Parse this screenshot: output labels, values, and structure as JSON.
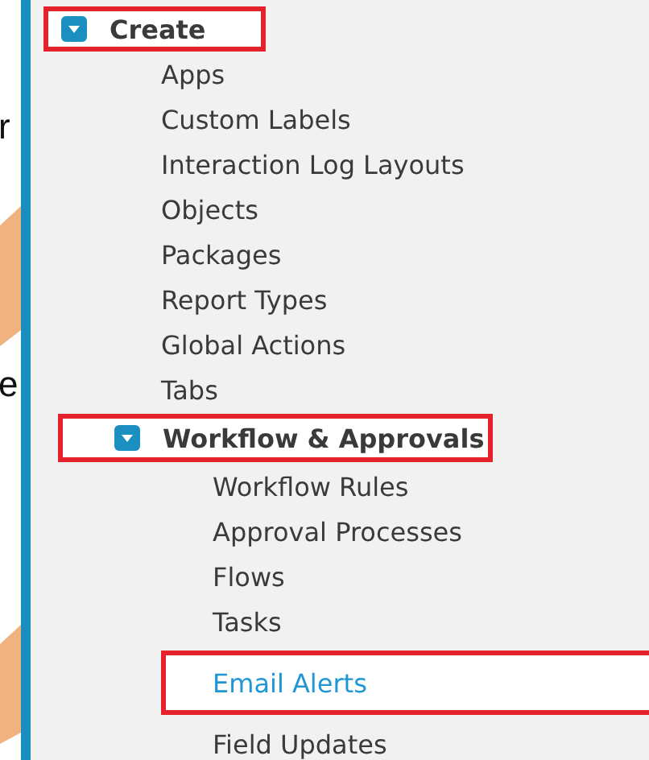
{
  "background_fragments": [
    {
      "text": "r"
    },
    {
      "text": "e"
    }
  ],
  "tree": [
    {
      "label": "Create",
      "expanded": true,
      "highlighted": true,
      "children": [
        {
          "label": "Apps",
          "highlighted": false,
          "selected": false
        },
        {
          "label": "Custom Labels",
          "highlighted": false,
          "selected": false
        },
        {
          "label": "Interaction Log Layouts",
          "highlighted": false,
          "selected": false
        },
        {
          "label": "Objects",
          "highlighted": false,
          "selected": false
        },
        {
          "label": "Packages",
          "highlighted": false,
          "selected": false
        },
        {
          "label": "Report Types",
          "highlighted": false,
          "selected": false
        },
        {
          "label": "Global Actions",
          "highlighted": false,
          "selected": false
        },
        {
          "label": "Tabs",
          "highlighted": false,
          "selected": false
        },
        {
          "label": "Workflow & Approvals",
          "expanded": true,
          "highlighted": true,
          "children": [
            {
              "label": "Workflow Rules",
              "highlighted": false,
              "selected": false
            },
            {
              "label": "Approval Processes",
              "highlighted": false,
              "selected": false
            },
            {
              "label": "Flows",
              "highlighted": false,
              "selected": false
            },
            {
              "label": "Tasks",
              "highlighted": false,
              "selected": false
            },
            {
              "label": "Email Alerts",
              "highlighted": true,
              "selected": true
            },
            {
              "label": "Field Updates",
              "highlighted": false,
              "selected": false
            }
          ]
        }
      ]
    }
  ]
}
